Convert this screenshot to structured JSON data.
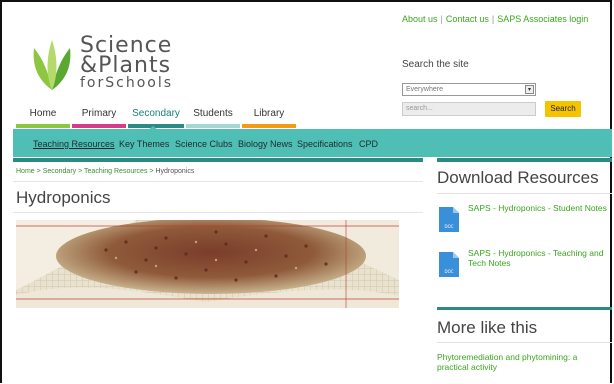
{
  "logo": {
    "line1": "Science",
    "line2": "&Plants",
    "line3": "forSchools"
  },
  "top_links": {
    "about": "About us",
    "contact": "Contact us",
    "associates": "SAPS Associates login",
    "sep": "|"
  },
  "search": {
    "title": "Search the site",
    "scope_selected": "Everywhere",
    "placeholder": "search...",
    "button": "Search"
  },
  "main_nav": [
    {
      "label": "Home",
      "color": "#8dc63f"
    },
    {
      "label": "Primary",
      "color": "#d63c8b"
    },
    {
      "label": "Secondary",
      "color": "#2b8a84"
    },
    {
      "label": "Students",
      "color": "#a6d8d3"
    },
    {
      "label": "Library",
      "color": "#f39c12"
    }
  ],
  "sub_nav": [
    {
      "label": "Teaching Resources"
    },
    {
      "label": "Key Themes"
    },
    {
      "label": "Science Clubs"
    },
    {
      "label": "Biology News"
    },
    {
      "label": "Specifications"
    },
    {
      "label": "CPD"
    }
  ],
  "breadcrumb": {
    "home": "Home",
    "sep": ">",
    "secondary": "Secondary",
    "teaching": "Teaching Resources",
    "current": "Hydroponics"
  },
  "page_title": "Hydroponics",
  "download": {
    "title": "Download Resources",
    "icon_label": "DOC",
    "items": [
      {
        "label": "SAPS - Hydroponics - Student Notes"
      },
      {
        "label": "SAPS - Hydroponics - Teaching and Tech Notes"
      }
    ]
  },
  "more_like_this": {
    "title": "More like this",
    "items": [
      {
        "label": "Phytoremediation and phytomining: a practical activity"
      }
    ]
  },
  "colors": {
    "teal": "#4fbfb6",
    "dark_teal": "#2b8a84",
    "link_green": "#39a61d",
    "search_button": "#f5c400"
  }
}
